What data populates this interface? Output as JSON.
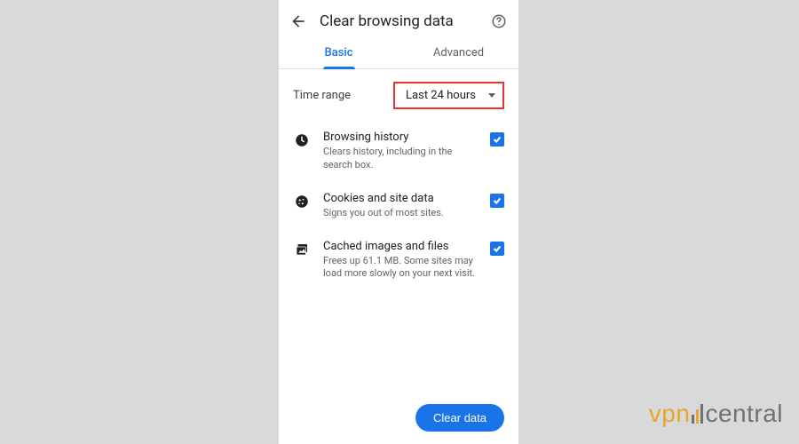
{
  "header": {
    "title": "Clear browsing data"
  },
  "tabs": {
    "basic": "Basic",
    "advanced": "Advanced"
  },
  "time_range": {
    "label": "Time range",
    "selected": "Last 24 hours"
  },
  "options": [
    {
      "title": "Browsing history",
      "desc": "Clears history, including in the search box.",
      "checked": true,
      "icon": "clock-icon"
    },
    {
      "title": "Cookies and site data",
      "desc": "Signs you out of most sites.",
      "checked": true,
      "icon": "cookie-icon"
    },
    {
      "title": "Cached images and files",
      "desc": "Frees up 61.1 MB. Some sites may load more slowly on your next visit.",
      "checked": true,
      "icon": "image-stack-icon"
    }
  ],
  "footer": {
    "clear_button": "Clear data"
  },
  "watermark": {
    "part1": "vpn",
    "part2": "central"
  }
}
